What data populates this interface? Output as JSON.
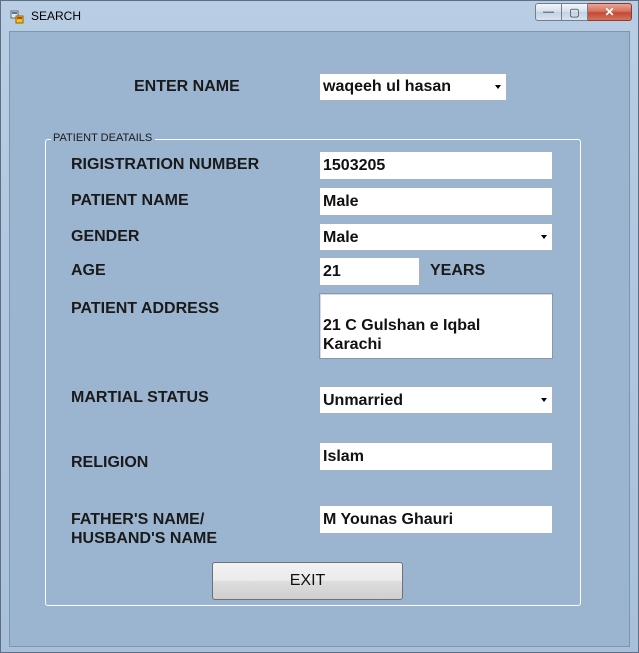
{
  "window": {
    "title": "SEARCH",
    "minimize_label": "—",
    "maximize_label": "▢",
    "close_label": "✕"
  },
  "search": {
    "label": "ENTER NAME",
    "value": "waqeeh ul hasan"
  },
  "group": {
    "legend": "PATIENT DEATAILS"
  },
  "fields": {
    "registration_number": {
      "label": "RIGISTRATION NUMBER",
      "value": "1503205"
    },
    "patient_name": {
      "label": "PATIENT NAME",
      "value": "Male"
    },
    "gender": {
      "label": "GENDER",
      "value": "Male"
    },
    "age": {
      "label": "AGE",
      "value": "21",
      "unit": "YEARS"
    },
    "patient_address": {
      "label": "PATIENT ADDRESS",
      "value": "21 C Gulshan e Iqbal\nKarachi"
    },
    "martial_status": {
      "label": "MARTIAL STATUS",
      "value": "Unmarried"
    },
    "religion": {
      "label": "RELIGION",
      "value": "Islam"
    },
    "father_name": {
      "label_line1": "FATHER'S NAME/",
      "label_line2": "HUSBAND'S NAME",
      "value": "M Younas Ghauri"
    }
  },
  "buttons": {
    "exit_label": "EXIT"
  },
  "icons": {
    "app_icon": "windows-form-icon",
    "dropdown_arrow": "chevron-down-icon"
  }
}
